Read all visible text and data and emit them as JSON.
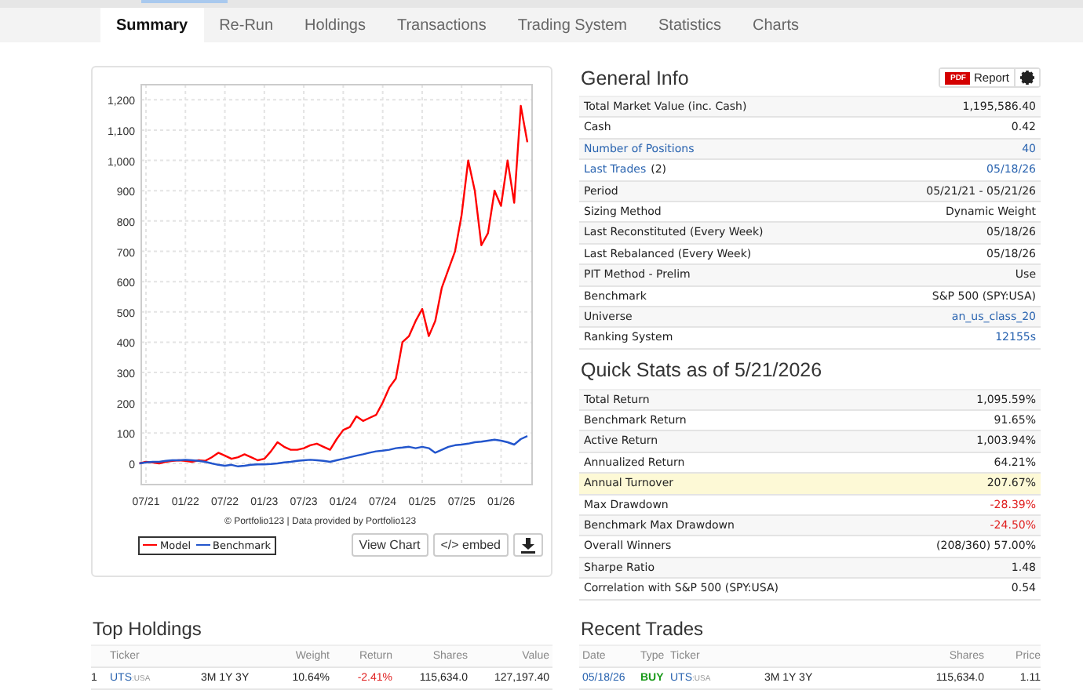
{
  "tabs": [
    {
      "label": "Summary",
      "selected": true
    },
    {
      "label": "Re-Run",
      "selected": false
    },
    {
      "label": "Holdings",
      "selected": false
    },
    {
      "label": "Transactions",
      "selected": false
    },
    {
      "label": "Trading System",
      "selected": false
    },
    {
      "label": "Statistics",
      "selected": false
    },
    {
      "label": "Charts",
      "selected": false
    }
  ],
  "chart": {
    "credit": "© Portfolio123 | Data provided by Portfolio123",
    "buttons": [
      "View Chart",
      "</> embed"
    ],
    "chart_data": {
      "type": "line",
      "grid": true,
      "categories": [
        null,
        "07/21",
        null,
        null,
        null,
        null,
        null,
        "01/22",
        null,
        null,
        null,
        null,
        null,
        "07/22",
        null,
        null,
        null,
        null,
        null,
        "01/23",
        null,
        null,
        null,
        null,
        null,
        "07/23",
        null,
        null,
        null,
        null,
        null,
        "01/24",
        null,
        null,
        null,
        null,
        null,
        "07/24",
        null,
        null,
        null,
        null,
        null,
        "01/25",
        null,
        null,
        null,
        null,
        null,
        "07/25",
        null,
        null,
        null,
        null,
        null,
        "01/26",
        null,
        null,
        null,
        null
      ],
      "series": [
        {
          "name": "Model",
          "color": "#ff0000",
          "values": [
            0,
            5,
            3,
            0,
            5,
            8,
            10,
            8,
            5,
            10,
            8,
            20,
            35,
            25,
            15,
            20,
            30,
            20,
            10,
            15,
            40,
            70,
            55,
            45,
            45,
            50,
            60,
            65,
            55,
            45,
            80,
            110,
            120,
            155,
            140,
            150,
            160,
            200,
            250,
            280,
            400,
            420,
            470,
            510,
            420,
            470,
            580,
            640,
            700,
            820,
            1000,
            900,
            720,
            760,
            900,
            850,
            1000,
            860,
            1180,
            1060
          ]
        },
        {
          "name": "Benchmark",
          "color": "#2255cc",
          "values": [
            0,
            3,
            5,
            5,
            8,
            10,
            10,
            12,
            10,
            8,
            5,
            0,
            -5,
            -8,
            -5,
            -10,
            -8,
            -5,
            -3,
            -3,
            -2,
            0,
            3,
            5,
            8,
            10,
            12,
            10,
            8,
            5,
            10,
            15,
            20,
            25,
            30,
            35,
            40,
            42,
            45,
            50,
            52,
            55,
            50,
            55,
            50,
            35,
            45,
            55,
            60,
            62,
            65,
            70,
            72,
            75,
            78,
            75,
            70,
            62,
            80,
            90
          ]
        }
      ],
      "ylim": [
        -70,
        1250
      ],
      "yticks": [
        {
          "value": 0,
          "label": "0"
        },
        {
          "value": 100,
          "label": "100"
        },
        {
          "value": 200,
          "label": "200"
        },
        {
          "value": 300,
          "label": "300"
        },
        {
          "value": 400,
          "label": "400"
        },
        {
          "value": 500,
          "label": "500"
        },
        {
          "value": 600,
          "label": "600"
        },
        {
          "value": 700,
          "label": "700"
        },
        {
          "value": 800,
          "label": "800"
        },
        {
          "value": 900,
          "label": "900"
        },
        {
          "value": 1000,
          "label": "1,000"
        },
        {
          "value": 1100,
          "label": "1,100"
        },
        {
          "value": 1200,
          "label": "1,200"
        }
      ]
    }
  },
  "general_info": {
    "title": "General Info",
    "pdf_badge": "PDF",
    "report_button": "Report",
    "rows": [
      {
        "label": "Total Market Value (inc. Cash)",
        "value": "1,195,586.40",
        "label_link": false,
        "value_link": false
      },
      {
        "label": "Cash",
        "value": "0.42",
        "label_link": false,
        "value_link": false
      },
      {
        "label": "Number of Positions",
        "value": "40",
        "label_link": true,
        "value_link": true
      },
      {
        "label": "Last Trades",
        "label_suffix": "(2)",
        "value": "05/18/26",
        "label_link": true,
        "value_link": true
      },
      {
        "label": "Period",
        "value": "05/21/21 - 05/21/26",
        "label_link": false,
        "value_link": false
      },
      {
        "label": "Sizing Method",
        "value": "Dynamic Weight",
        "label_link": false,
        "value_link": false
      },
      {
        "label": "Last Reconstituted (Every Week)",
        "value": "05/18/26",
        "label_link": false,
        "value_link": false
      },
      {
        "label": "Last Rebalanced (Every Week)",
        "value": "05/18/26",
        "label_link": false,
        "value_link": false
      },
      {
        "label": "PIT Method - Prelim",
        "value": "Use",
        "label_link": false,
        "value_link": false
      },
      {
        "label": "Benchmark",
        "value": "S&P 500 (SPY:USA)",
        "label_link": false,
        "value_link": false
      },
      {
        "label": "Universe",
        "value": "an_us_class_20",
        "label_link": false,
        "value_link": true
      },
      {
        "label": "Ranking System",
        "value": "12155s",
        "label_link": false,
        "value_link": true
      }
    ]
  },
  "quick_stats": {
    "title": "Quick Stats as of 5/21/2026",
    "rows": [
      {
        "label": "Total Return",
        "value": "1,095.59%",
        "highlighted": false,
        "negative": false
      },
      {
        "label": "Benchmark Return",
        "value": "91.65%",
        "highlighted": false,
        "negative": false
      },
      {
        "label": "Active Return",
        "value": "1,003.94%",
        "highlighted": false,
        "negative": false
      },
      {
        "label": "Annualized Return",
        "value": "64.21%",
        "highlighted": false,
        "negative": false
      },
      {
        "label": "Annual Turnover",
        "value": "207.67%",
        "highlighted": true,
        "negative": false
      },
      {
        "label": "Max Drawdown",
        "value": "-28.39%",
        "highlighted": false,
        "negative": true
      },
      {
        "label": "Benchmark Max Drawdown",
        "value": "-24.50%",
        "highlighted": false,
        "negative": true
      },
      {
        "label": "Overall Winners",
        "value": "(208/360) 57.00%",
        "highlighted": false,
        "negative": false
      },
      {
        "label": "Sharpe Ratio",
        "value": "1.48",
        "highlighted": false,
        "negative": false
      },
      {
        "label": "Correlation with S&P 500 (SPY:USA)",
        "value": "0.54",
        "highlighted": false,
        "negative": false
      }
    ]
  },
  "top_holdings": {
    "title": "Top Holdings",
    "columns": [
      "Ticker",
      "Weight",
      "Return",
      "Shares",
      "Value"
    ],
    "rows": [
      {
        "rank": "1",
        "ticker": "UTS",
        "exchange": ":USA",
        "periods": "3M 1Y 3Y",
        "weight": "10.64%",
        "return": "-2.41%",
        "return_negative": true,
        "shares": "115,634.0",
        "value": "127,197.40"
      }
    ]
  },
  "recent_trades": {
    "title": "Recent Trades",
    "columns": [
      "Date",
      "Type",
      "Ticker",
      "Shares",
      "Price"
    ],
    "rows": [
      {
        "date": "05/18/26",
        "type": "BUY",
        "kind": "buy",
        "ticker": "UTS",
        "exchange": ":USA",
        "periods": "3M 1Y 3Y",
        "shares": "115,634.0",
        "price": "1.11"
      }
    ]
  }
}
